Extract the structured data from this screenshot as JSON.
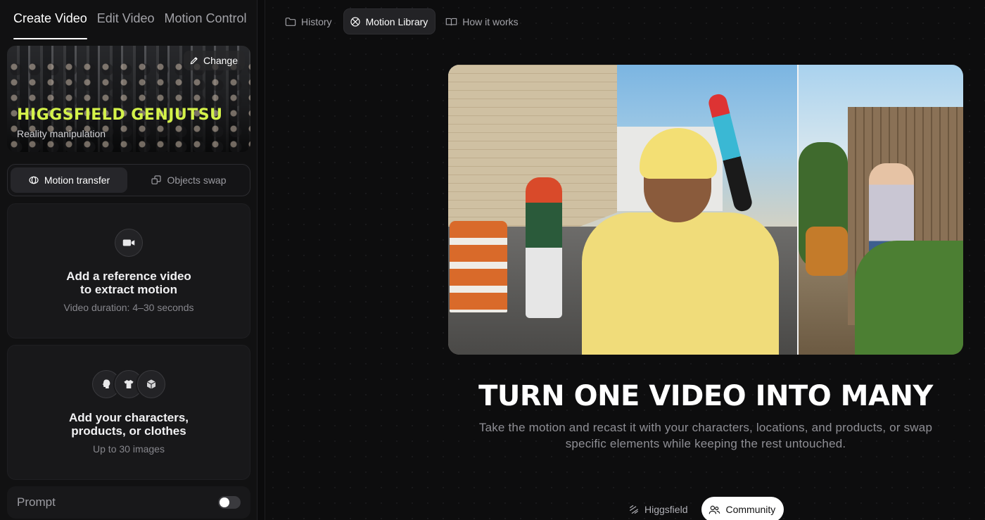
{
  "sidebar": {
    "tabs": [
      {
        "label": "Create Video",
        "active": true
      },
      {
        "label": "Edit Video",
        "active": false
      },
      {
        "label": "Motion Control",
        "active": false
      }
    ],
    "preset": {
      "title": "HIGGSFIELD GENJUTSU",
      "subtitle": "Reality manipulation",
      "change_label": "Change",
      "title_color": "#d4f24a"
    },
    "modes": [
      {
        "label": "Motion transfer",
        "icon": "motion-icon",
        "active": true
      },
      {
        "label": "Objects swap",
        "icon": "swap-icon",
        "active": false
      }
    ],
    "video_upload": {
      "title_line1": "Add a reference video",
      "title_line2": "to extract motion",
      "subtitle": "Video duration: 4–30 seconds",
      "icon": "video-camera-icon"
    },
    "refs_upload": {
      "title_line1": "Add your characters,",
      "title_line2": "products, or clothes",
      "subtitle": "Up to 30 images",
      "icons": [
        "head-icon",
        "shirt-icon",
        "box-icon"
      ]
    },
    "prompt": {
      "label": "Prompt",
      "enabled": false
    }
  },
  "main": {
    "nav": [
      {
        "label": "History",
        "icon": "folder-icon",
        "active": false
      },
      {
        "label": "Motion Library",
        "icon": "motion-library-icon",
        "active": true
      },
      {
        "label": "How it works",
        "icon": "book-icon",
        "active": false
      }
    ],
    "headline": "TURN ONE VIDEO INTO MANY",
    "subline": "Take the motion and recast it with your characters, locations, and products, or swap specific elements while keeping the rest untouched.",
    "source_tabs": [
      {
        "label": "Higgsfield",
        "icon": "higgsfield-logo-icon",
        "active": false
      },
      {
        "label": "Community",
        "icon": "users-icon",
        "active": true
      }
    ]
  },
  "colors": {
    "background": "#0b0b0c",
    "sidebar": "#111112",
    "accent_lime": "#d4f24a"
  }
}
